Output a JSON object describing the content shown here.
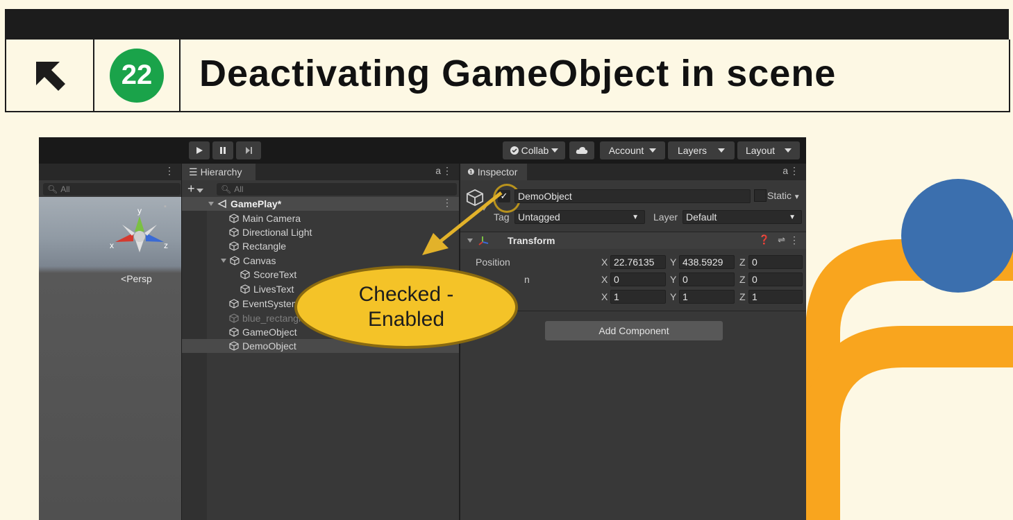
{
  "header": {
    "step_number": "22",
    "title": "Deactivating GameObject in scene",
    "arrow_icon": "north-west-arrow-icon"
  },
  "colors": {
    "header_bar": "#1c1c1c",
    "page_bg": "#fdf8e4",
    "number_circle": "#1aa34a",
    "callout_fill": "#f4c328",
    "deco_orange": "#f9a51e",
    "deco_blue": "#3b6fae"
  },
  "toolbar": {
    "collab": "Collab",
    "account": "Account",
    "layers": "Layers",
    "layout": "Layout"
  },
  "scene": {
    "search_placeholder": "All",
    "persp_label": "Persp",
    "axis_y": "y",
    "axis_x": "x",
    "axis_z": "z"
  },
  "hierarchy": {
    "tab_label": "Hierarchy",
    "search_placeholder": "All",
    "scene_name": "GamePlay*",
    "items": [
      {
        "label": "Main Camera"
      },
      {
        "label": "Directional Light"
      },
      {
        "label": "Rectangle"
      },
      {
        "label": "Canvas"
      },
      {
        "label": "ScoreText"
      },
      {
        "label": "LivesText"
      },
      {
        "label": "EventSystem"
      },
      {
        "label": "blue_rectangle"
      },
      {
        "label": "GameObject"
      },
      {
        "label": "DemoObject"
      }
    ]
  },
  "inspector": {
    "tab_label": "Inspector",
    "object_name": "DemoObject",
    "active_checked": true,
    "static_label": "Static",
    "tag_label": "Tag",
    "tag_value": "Untagged",
    "layer_label": "Layer",
    "layer_value": "Default",
    "component_title": "Transform",
    "position_label": "Position",
    "rotation_label_partial": "n",
    "position": {
      "x": "22.76135",
      "y": "438.5929",
      "z": "0"
    },
    "rotation": {
      "x": "0",
      "y": "0",
      "z": "0"
    },
    "scale": {
      "x": "1",
      "y": "1",
      "z": "1"
    },
    "axis_x": "X",
    "axis_y": "Y",
    "axis_z": "Z",
    "add_component": "Add Component"
  },
  "callout": {
    "line1": "Checked -",
    "line2": "Enabled"
  }
}
